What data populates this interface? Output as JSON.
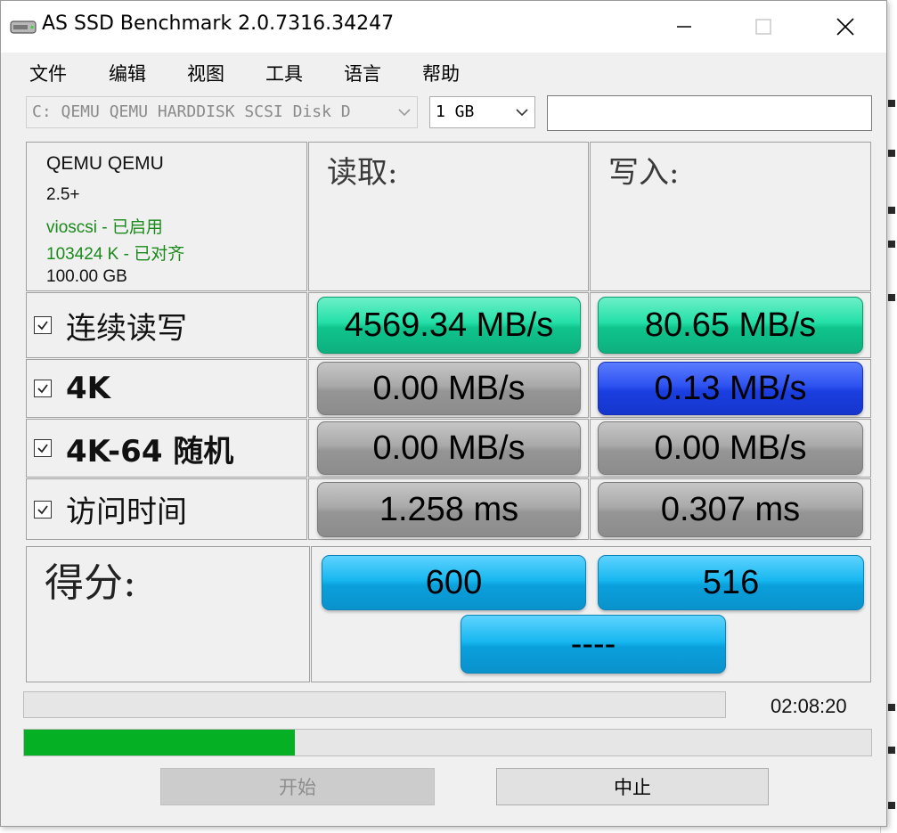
{
  "window": {
    "title": "AS SSD Benchmark 2.0.7316.34247",
    "controls": {
      "minimize_icon": "minimize-icon",
      "maximize_icon": "maximize-icon",
      "close_icon": "close-icon"
    }
  },
  "menu": [
    "文件",
    "编辑",
    "视图",
    "工具",
    "语言",
    "帮助"
  ],
  "toolbar": {
    "disk_select": "C: QEMU QEMU HARDDISK SCSI Disk D",
    "size_select": "1 GB",
    "name_field": ""
  },
  "drive_info": {
    "model": "QEMU QEMU",
    "firmware": "2.5+",
    "driver": "vioscsi - 已启用",
    "alignment": "103424 K - 已对齐",
    "capacity": "100.00 GB",
    "ok_color": "#1a8a1a"
  },
  "columns": {
    "read": "读取:",
    "write": "写入:"
  },
  "rows": [
    {
      "label": "连续读写",
      "checked": true,
      "read": "4569.34 MB/s",
      "write": "80.65 MB/s",
      "read_color": "green",
      "write_color": "green"
    },
    {
      "label": "4K",
      "checked": true,
      "read": "0.00 MB/s",
      "write": "0.13 MB/s",
      "read_color": "gray",
      "write_color": "blue"
    },
    {
      "label": "4K-64 随机",
      "checked": true,
      "read": "0.00 MB/s",
      "write": "0.00 MB/s",
      "read_color": "gray",
      "write_color": "gray"
    },
    {
      "label": "访问时间",
      "checked": true,
      "read": "1.258 ms",
      "write": "0.307 ms",
      "read_color": "gray",
      "write_color": "gray"
    }
  ],
  "score": {
    "label": "得分:",
    "read": "600",
    "write": "516",
    "total": "----"
  },
  "status": {
    "elapsed": "02:08:20",
    "main_progress": 0.32,
    "main_progress_color": "#06b025"
  },
  "buttons": {
    "start": "开始",
    "stop": "中止"
  }
}
